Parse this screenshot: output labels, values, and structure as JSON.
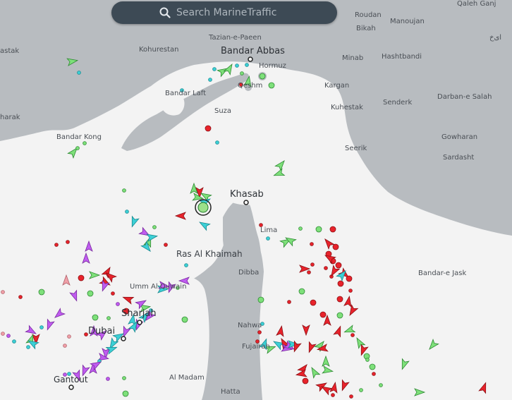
{
  "search": {
    "placeholder": "Search MarineTraffic"
  },
  "places": [
    {
      "name": "Qaleh Ganj"
    },
    {
      "name": "Roudan"
    },
    {
      "name": "Manoujan"
    },
    {
      "name": "Bikah"
    },
    {
      "name": "Tazian-e-Paeen"
    },
    {
      "name": "Kohurestan"
    },
    {
      "name": "Bandar Abbas"
    },
    {
      "name": "Minab"
    },
    {
      "name": "Hashtbandi"
    },
    {
      "name": "Hormuz"
    },
    {
      "name": "Qeshm"
    },
    {
      "name": "Kargan"
    },
    {
      "name": "Bandar Laft"
    },
    {
      "name": "Darban-e Salah"
    },
    {
      "name": "Senderk"
    },
    {
      "name": "Kuhestak"
    },
    {
      "name": "Suza"
    },
    {
      "name": "Bandar Kong"
    },
    {
      "name": "Gowharan"
    },
    {
      "name": "Seerik"
    },
    {
      "name": "Sardasht"
    },
    {
      "name": "Khasab"
    },
    {
      "name": "Lima"
    },
    {
      "name": "Ras Al Khaimah"
    },
    {
      "name": "Dibba"
    },
    {
      "name": "Bandar-e Jask"
    },
    {
      "name": "Umm Al Quwain"
    },
    {
      "name": "Sharjah"
    },
    {
      "name": "Dubai"
    },
    {
      "name": "Nahwa"
    },
    {
      "name": "Fujairah"
    },
    {
      "name": "Gantout"
    },
    {
      "name": "Al Madam"
    },
    {
      "name": "Hatta"
    },
    {
      "name": "astak"
    },
    {
      "name": "harak"
    },
    {
      "name": "ای‌خ"
    }
  ],
  "colors": {
    "sea": "#f3f3f3",
    "land": "#b8bcc0",
    "cargo": "#7ee07a",
    "tanker": "#e8232b",
    "passenger": "#3cd0d6",
    "pleasure": "#c05cf0",
    "unknown": "#f0a0a8",
    "search_bar": "#3d4a55"
  },
  "icons": [
    "search-icon",
    "port-icon",
    "vessel-arrow-icon",
    "vessel-dot-icon",
    "selected-vessel-icon"
  ]
}
